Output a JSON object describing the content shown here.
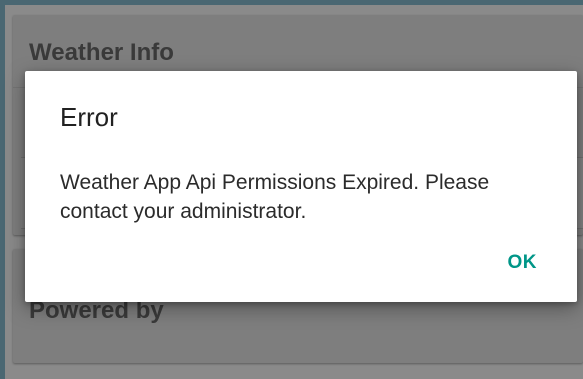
{
  "background": {
    "weather_card": {
      "title": "Weather Info"
    },
    "powered_card": {
      "title": "Powered by"
    }
  },
  "dialog": {
    "title": "Error",
    "message": "Weather App Api Permissions Expired. Please contact your administrator.",
    "ok_label": "OK"
  },
  "colors": {
    "accent": "#009688",
    "dialog_background": "#ffffff",
    "scrim": "#8a8a8a",
    "title_text": "#212121",
    "body_text": "#2b2b2b"
  }
}
